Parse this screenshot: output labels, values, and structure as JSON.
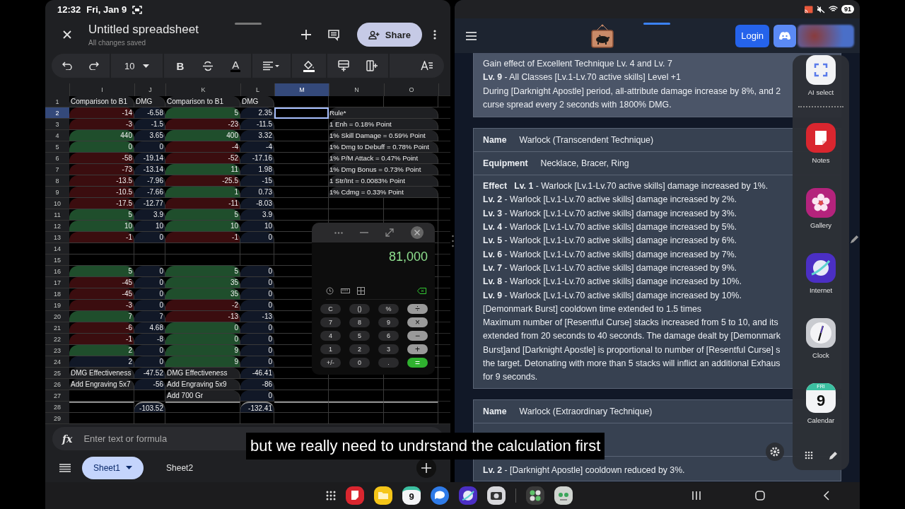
{
  "status_left": {
    "time": "12:32",
    "date": "Fri, Jan 9"
  },
  "sheets": {
    "title": "Untitled spreadsheet",
    "save_status": "All changes saved",
    "share_label": "Share",
    "toolbar": {
      "font_size": "10",
      "bold": "B",
      "text_color": "A"
    },
    "columns": [
      {
        "label": "I",
        "selected": false
      },
      {
        "label": "J",
        "selected": false
      },
      {
        "label": "K",
        "selected": false
      },
      {
        "label": "L",
        "selected": false
      },
      {
        "label": "M",
        "selected": true
      },
      {
        "label": "N",
        "selected": false
      },
      {
        "label": "O",
        "selected": false
      }
    ],
    "rows": [
      {
        "label": "1",
        "kind": "header",
        "selected": false,
        "cells": {
          "I": {
            "text": "Comparison to B1"
          },
          "J": {
            "text": "DMG"
          },
          "K": {
            "text": "Comparison to B1"
          },
          "L": {
            "text": "DMG"
          }
        }
      },
      {
        "label": "2",
        "kind": "data",
        "selected": true,
        "cells": {
          "I": {
            "text": "-14",
            "color": "#3b0d0f"
          },
          "J": {
            "text": "-6.58"
          },
          "K": {
            "text": "5",
            "color": "#1f4e2c"
          },
          "L": {
            "text": "2.35"
          },
          "N": {
            "text": "Rule*"
          }
        }
      },
      {
        "label": "3",
        "kind": "data",
        "selected": false,
        "cells": {
          "I": {
            "text": "-3",
            "color": "#3b0d0f"
          },
          "J": {
            "text": "-1.5"
          },
          "K": {
            "text": "-23",
            "color": "#3b0d0f"
          },
          "L": {
            "text": "-11.5"
          },
          "N": {
            "text": "1 Enh = 0.18% Point"
          }
        }
      },
      {
        "label": "4",
        "kind": "data",
        "selected": false,
        "cells": {
          "I": {
            "text": "440",
            "color": "#1f4e2c"
          },
          "J": {
            "text": "3.65"
          },
          "K": {
            "text": "400",
            "color": "#1f4e2c"
          },
          "L": {
            "text": "3.32"
          },
          "N": {
            "text": "1% Skill Damage = 0.59% Point"
          }
        }
      },
      {
        "label": "5",
        "kind": "data",
        "selected": false,
        "cells": {
          "I": {
            "text": "0",
            "color": "#1f4e2c"
          },
          "J": {
            "text": "0"
          },
          "K": {
            "text": "-4",
            "color": "#3b0d0f"
          },
          "L": {
            "text": "-4"
          },
          "N": {
            "text": "1% Dmg to Debuff = 0.78% Point"
          }
        }
      },
      {
        "label": "6",
        "kind": "data",
        "selected": false,
        "cells": {
          "I": {
            "text": "-58",
            "color": "#3b0d0f"
          },
          "J": {
            "text": "-19.14"
          },
          "K": {
            "text": "-52",
            "color": "#3b0d0f"
          },
          "L": {
            "text": "-17.16"
          },
          "N": {
            "text": "1% P/M Attack = 0.47% Point"
          }
        }
      },
      {
        "label": "7",
        "kind": "data",
        "selected": false,
        "cells": {
          "I": {
            "text": "-73",
            "color": "#3b0d0f"
          },
          "J": {
            "text": "-13.14"
          },
          "K": {
            "text": "11",
            "color": "#1f4e2c"
          },
          "L": {
            "text": "1.98"
          },
          "N": {
            "text": "1% Dmg Bonus = 0.73% Point"
          }
        }
      },
      {
        "label": "8",
        "kind": "data",
        "selected": false,
        "cells": {
          "I": {
            "text": "-13.5",
            "color": "#3b0d0f"
          },
          "J": {
            "text": "-7.96"
          },
          "K": {
            "text": "-25.5",
            "color": "#3b0d0f"
          },
          "L": {
            "text": "-15"
          },
          "N": {
            "text": "1 Str/Int = 0.0083% Point"
          }
        }
      },
      {
        "label": "9",
        "kind": "data",
        "selected": false,
        "cells": {
          "I": {
            "text": "-10.5",
            "color": "#3b0d0f"
          },
          "J": {
            "text": "-7.66"
          },
          "K": {
            "text": "1",
            "color": "#1f4e2c"
          },
          "L": {
            "text": "0.73"
          },
          "N": {
            "text": "1% Cdmg = 0.33% Point"
          }
        }
      },
      {
        "label": "10",
        "kind": "data",
        "selected": false,
        "cells": {
          "I": {
            "text": "-17.5",
            "color": "#3b0d0f"
          },
          "J": {
            "text": "-12.77"
          },
          "K": {
            "text": "-11",
            "color": "#3b0d0f"
          },
          "L": {
            "text": "-8.03"
          }
        }
      },
      {
        "label": "11",
        "kind": "data",
        "selected": false,
        "cells": {
          "I": {
            "text": "5",
            "color": "#1f4e2c"
          },
          "J": {
            "text": "3.9"
          },
          "K": {
            "text": "5",
            "color": "#1f4e2c"
          },
          "L": {
            "text": "3.9"
          }
        }
      },
      {
        "label": "12",
        "kind": "data",
        "selected": false,
        "cells": {
          "I": {
            "text": "10",
            "color": "#1f4e2c"
          },
          "J": {
            "text": "10"
          },
          "K": {
            "text": "10",
            "color": "#1f4e2c"
          },
          "L": {
            "text": "10"
          }
        }
      },
      {
        "label": "13",
        "kind": "data",
        "selected": false,
        "cells": {
          "I": {
            "text": "-1",
            "color": "#3b0d0f"
          },
          "J": {
            "text": "0"
          },
          "K": {
            "text": "-1",
            "color": "#3b0d0f"
          },
          "L": {
            "text": "0"
          }
        }
      },
      {
        "label": "14",
        "kind": "data",
        "selected": false
      },
      {
        "label": "15",
        "kind": "data",
        "selected": false
      },
      {
        "label": "16",
        "kind": "data",
        "selected": false,
        "cells": {
          "I": {
            "text": "5",
            "color": "#1f4e2c"
          },
          "J": {
            "text": "0"
          },
          "K": {
            "text": "5",
            "color": "#1f4e2c"
          },
          "L": {
            "text": "0"
          }
        }
      },
      {
        "label": "17",
        "kind": "data",
        "selected": false,
        "cells": {
          "I": {
            "text": "-45",
            "color": "#3b0d0f"
          },
          "J": {
            "text": "0"
          },
          "K": {
            "text": "35",
            "color": "#1f4e2c"
          },
          "L": {
            "text": "0"
          }
        }
      },
      {
        "label": "18",
        "kind": "data",
        "selected": false,
        "cells": {
          "I": {
            "text": "-45",
            "color": "#3b0d0f"
          },
          "J": {
            "text": "0"
          },
          "K": {
            "text": "35",
            "color": "#1f4e2c"
          },
          "L": {
            "text": "0"
          }
        }
      },
      {
        "label": "19",
        "kind": "data",
        "selected": false,
        "cells": {
          "I": {
            "text": "-3",
            "color": "#3b0d0f"
          },
          "J": {
            "text": "0"
          },
          "K": {
            "text": "-2",
            "color": "#3b0d0f"
          },
          "L": {
            "text": "0"
          }
        }
      },
      {
        "label": "20",
        "kind": "data",
        "selected": false,
        "cells": {
          "I": {
            "text": "7",
            "color": "#1f4e2c"
          },
          "J": {
            "text": "7"
          },
          "K": {
            "text": "-13",
            "color": "#3b0d0f"
          },
          "L": {
            "text": "-13"
          }
        }
      },
      {
        "label": "21",
        "kind": "data",
        "selected": false,
        "cells": {
          "I": {
            "text": "-6",
            "color": "#3b0d0f"
          },
          "J": {
            "text": "4.68"
          },
          "K": {
            "text": "0",
            "color": "#1f4e2c"
          },
          "L": {
            "text": "0"
          }
        }
      },
      {
        "label": "22",
        "kind": "data",
        "selected": false,
        "cells": {
          "I": {
            "text": "-1",
            "color": "#3b0d0f"
          },
          "J": {
            "text": "-8"
          },
          "K": {
            "text": "0",
            "color": "#1f4e2c"
          },
          "L": {
            "text": "0"
          }
        }
      },
      {
        "label": "23",
        "kind": "data",
        "selected": false,
        "cells": {
          "I": {
            "text": "2",
            "color": "#1f4e2c"
          },
          "J": {
            "text": "0"
          },
          "K": {
            "text": "9",
            "color": "#1f4e2c"
          },
          "L": {
            "text": "0"
          }
        }
      },
      {
        "label": "24",
        "kind": "data",
        "selected": false,
        "cells": {
          "I": {
            "text": "2"
          },
          "J": {
            "text": "0"
          },
          "K": {
            "text": "9",
            "color": "#1f4e2c"
          },
          "L": {
            "text": "0"
          }
        }
      },
      {
        "label": "25",
        "kind": "summary",
        "selected": false,
        "cells": {
          "I": {
            "text": "DMG Effectiveness"
          },
          "J": {
            "text": "-47.52"
          },
          "K": {
            "text": "DMG Effectiveness"
          },
          "L": {
            "text": "-46.41"
          }
        }
      },
      {
        "label": "26",
        "kind": "summary",
        "selected": false,
        "cells": {
          "I": {
            "text": "Add Engraving 5x7"
          },
          "J": {
            "text": "-56"
          },
          "K": {
            "text": "Add Engraving 5x9"
          },
          "L": {
            "text": "-86"
          }
        }
      },
      {
        "label": "27",
        "kind": "summary",
        "selected": false,
        "cells": {
          "K": {
            "text": "Add 700 Gr"
          },
          "L": {
            "text": "0"
          }
        }
      },
      {
        "label": "28",
        "kind": "total",
        "selected": false,
        "cells": {
          "J": {
            "text": "-103.52"
          },
          "L": {
            "text": "-132.41"
          }
        }
      },
      {
        "label": "29",
        "kind": "data",
        "selected": false
      }
    ],
    "fx": "fx",
    "formula_placeholder": "Enter text or formula",
    "sheet_tabs": [
      {
        "label": "Sheet1",
        "selected": true
      },
      {
        "label": "Sheet2",
        "selected": false
      }
    ]
  },
  "calculator": {
    "display": "81,000",
    "keys": [
      {
        "label": "C",
        "kind": "function"
      },
      {
        "label": "()",
        "kind": "function"
      },
      {
        "label": "%",
        "kind": "function"
      },
      {
        "label": "÷",
        "kind": "operator"
      },
      {
        "label": "7",
        "kind": "digit"
      },
      {
        "label": "8",
        "kind": "digit"
      },
      {
        "label": "9",
        "kind": "digit"
      },
      {
        "label": "×",
        "kind": "operator"
      },
      {
        "label": "4",
        "kind": "digit"
      },
      {
        "label": "5",
        "kind": "digit"
      },
      {
        "label": "6",
        "kind": "digit"
      },
      {
        "label": "−",
        "kind": "operator"
      },
      {
        "label": "1",
        "kind": "digit"
      },
      {
        "label": "2",
        "kind": "digit"
      },
      {
        "label": "3",
        "kind": "digit"
      },
      {
        "label": "+",
        "kind": "operator"
      },
      {
        "label": "+/-",
        "kind": "function"
      },
      {
        "label": "0",
        "kind": "digit"
      },
      {
        "label": ".",
        "kind": "function"
      },
      {
        "label": "=",
        "kind": "equals"
      }
    ]
  },
  "caption": "but we really need to undrstand the calculation first",
  "status_right": {
    "battery": "91"
  },
  "website": {
    "login_label": "Login",
    "cards": [
      {
        "kind": "intro",
        "lines": [
          "Gain effect of Excellent Technique Lv. 4 and Lv. 7",
          "**Lv. 9** - All Classes [Lv.1-Lv.70 active skills] Level +1",
          "During [Darknight Apostle] period, all-attribute damage increase by 8%, and 2",
          "curse spread every 2 seconds with 1800% DMG."
        ]
      },
      {
        "kind": "full",
        "name_label": "Name",
        "name": "Warlock (Transcendent Technique)",
        "equipment_label": "Equipment",
        "equipment": "Necklace, Bracer, Ring",
        "effect_label": "Effect",
        "lines": [
          "**Lv. 1** - Warlock [Lv.1-Lv.70 active skills] damage increased by 1%.",
          "**Lv. 2** - Warlock [Lv.1-Lv.70 active skills] damage increased by 2%.",
          "**Lv. 3** - Warlock [Lv.1-Lv.70 active skills] damage increased by 3%.",
          "**Lv. 4** - Warlock [Lv.1-Lv.70 active skills] damage increased by 5%.",
          "**Lv. 5** - Warlock [Lv.1-Lv.70 active skills] damage increased by 6%.",
          "**Lv. 6** - Warlock [Lv.1-Lv.70 active skills] damage increased by 7%.",
          "**Lv. 7** - Warlock [Lv.1-Lv.70 active skills] damage increased by 9%.",
          "**Lv. 8** - Warlock [Lv.1-Lv.70 active skills] damage increased by 10%.",
          "**Lv. 9** - Warlock [Lv.1-Lv.70 active skills] damage increased by 10%.",
          "[Demonmark Burst] cooldown time extended to 1.5 times",
          "Maximum number of [Resentful Curse] stacks increased from 5 to 10, and its",
          "extended from 20 seconds to 40 seconds. The damage dealt by [Demonmark",
          "Burst]and [Darknight Apostle] is proportional to number of [Resentful Curse] s",
          "the target. Detonating with more than 5 stacks will inflict an additional Exhaus",
          "for 9 seconds."
        ]
      },
      {
        "kind": "covered",
        "name_label": "Name",
        "name": "Warlock (Extraordinary Technique)",
        "lines": [
          "**Lv. 2** - [Darknight Apostle] cooldown reduced by 3%."
        ]
      }
    ]
  },
  "edge_panel": {
    "apps": [
      {
        "kind": "ai-select",
        "label": "AI select"
      },
      {
        "kind": "notes",
        "label": "Notes"
      },
      {
        "kind": "gallery",
        "label": "Gallery"
      },
      {
        "kind": "internet",
        "label": "Internet"
      },
      {
        "kind": "clock",
        "label": "Clock"
      },
      {
        "kind": "calendar",
        "label": "Calendar",
        "weekday": "FRI",
        "day": "9"
      }
    ]
  },
  "taskbar": {
    "calendar_day": "9"
  }
}
